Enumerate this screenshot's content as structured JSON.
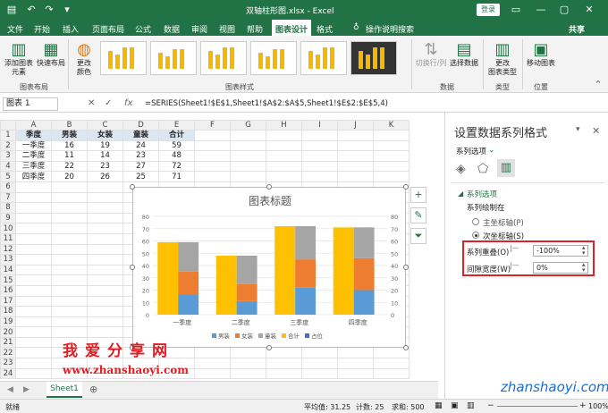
{
  "titlebar": {
    "title": "双轴柱形图.xlsx - Excel",
    "login": "登录"
  },
  "menu": [
    "文件",
    "开始",
    "插入",
    "页面布局",
    "公式",
    "数据",
    "审阅",
    "视图",
    "帮助",
    "图表设计",
    "格式"
  ],
  "menu_active": "图表设计",
  "tell_me": "操作说明搜索",
  "share": "共享",
  "ribbon": {
    "add_element": "添加图表\n元素",
    "quick_layout": "快速布局",
    "change_color": "更改\n颜色",
    "switch_rowcol": "切换行/列",
    "select_data": "选择数据",
    "change_type": "更改\n图表类型",
    "move_chart": "移动图表",
    "groups": {
      "layouts": "图表布局",
      "styles": "图表样式",
      "data": "数据",
      "type": "类型",
      "location": "位置"
    }
  },
  "formulabar": {
    "namebox": "图表 1",
    "fx": "fx",
    "formula": "=SERIES(Sheet1!$E$1,Sheet1!$A$2:$A$5,Sheet1!$E$2:$E$5,4)"
  },
  "sheet": {
    "columns": [
      "A",
      "B",
      "C",
      "D",
      "E",
      "F",
      "G",
      "H",
      "I",
      "J",
      "K"
    ],
    "rows": [
      "1",
      "2",
      "3",
      "4",
      "5",
      "6",
      "7",
      "8",
      "9",
      "10",
      "11",
      "12",
      "13",
      "14",
      "15",
      "16",
      "17",
      "18",
      "19",
      "20",
      "21",
      "22",
      "23",
      "24"
    ],
    "headers": [
      "季度",
      "男装",
      "女装",
      "童装",
      "合计"
    ],
    "data": [
      [
        "一季度",
        "16",
        "19",
        "24",
        "59"
      ],
      [
        "二季度",
        "11",
        "14",
        "23",
        "48"
      ],
      [
        "三季度",
        "22",
        "23",
        "27",
        "72"
      ],
      [
        "四季度",
        "20",
        "26",
        "25",
        "71"
      ]
    ]
  },
  "sheet_tab": "Sheet1",
  "status": {
    "ready": "就绪",
    "avg": "平均值: 31.25",
    "count": "计数: 25",
    "sum": "求和: 500",
    "zoom": "100%"
  },
  "pane": {
    "title": "设置数据系列格式",
    "options": "系列选项",
    "section": "系列选项",
    "plot_on": "系列绘制在",
    "primary": "主坐标轴(P)",
    "secondary": "次坐标轴(S)",
    "overlap_label": "系列重叠(O)",
    "overlap_value": "-100%",
    "gap_label": "间隙宽度(W)",
    "gap_value": "0%"
  },
  "watermark": {
    "cn": "我爱分享网",
    "url": "www.zhanshaoyi.com",
    "corner": "zhanshaoyi.com"
  },
  "colors": {
    "excel_green": "#217346",
    "male": "#5b9bd5",
    "female": "#ed7d31",
    "kids": "#a5a5a5",
    "total": "#ffc000",
    "placeholder": "#4472c4"
  },
  "chart_data": {
    "type": "bar",
    "title": "图表标题",
    "categories": [
      "一季度",
      "二季度",
      "三季度",
      "四季度"
    ],
    "series": [
      {
        "name": "男装",
        "values": [
          16,
          11,
          22,
          20
        ]
      },
      {
        "name": "女装",
        "values": [
          19,
          14,
          23,
          26
        ]
      },
      {
        "name": "童装",
        "values": [
          24,
          23,
          27,
          25
        ]
      },
      {
        "name": "合计",
        "values": [
          59,
          48,
          72,
          71
        ]
      },
      {
        "name": "占位",
        "values": [
          0,
          0,
          0,
          0
        ]
      }
    ],
    "yticks": [
      "0",
      "10",
      "20",
      "30",
      "40",
      "50",
      "60",
      "70",
      "80"
    ],
    "ylim": [
      0,
      80
    ],
    "stacked_series": [
      "男装",
      "女装",
      "童装"
    ],
    "secondary_series": [
      "合计"
    ],
    "legend_position": "bottom",
    "grid": true
  }
}
